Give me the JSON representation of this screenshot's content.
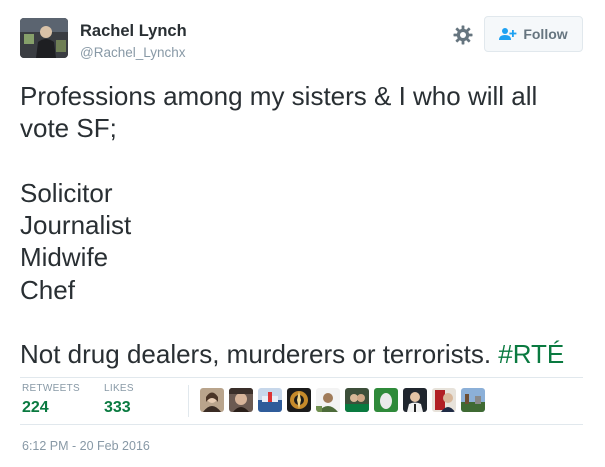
{
  "author": {
    "name": "Rachel Lynch",
    "handle": "@Rachel_Lynchx"
  },
  "follow_button": {
    "label": "Follow"
  },
  "tweet": {
    "lines": [
      "Professions among my sisters & I who will all",
      "vote SF;",
      "",
      "Solicitor",
      "Journalist",
      "Midwife",
      "Chef",
      "",
      "Not drug dealers, murderers or terrorists."
    ],
    "hashtag": "#RTÉ"
  },
  "stats": {
    "retweets_label": "RETWEETS",
    "retweets_value": "224",
    "likes_label": "LIKES",
    "likes_value": "333"
  },
  "timestamp": "6:12 PM - 20 Feb 2016",
  "colors": {
    "hashtag": "#0a7a40",
    "stat_value": "#0a7a40",
    "muted": "#8899a6",
    "text": "#292f33"
  }
}
